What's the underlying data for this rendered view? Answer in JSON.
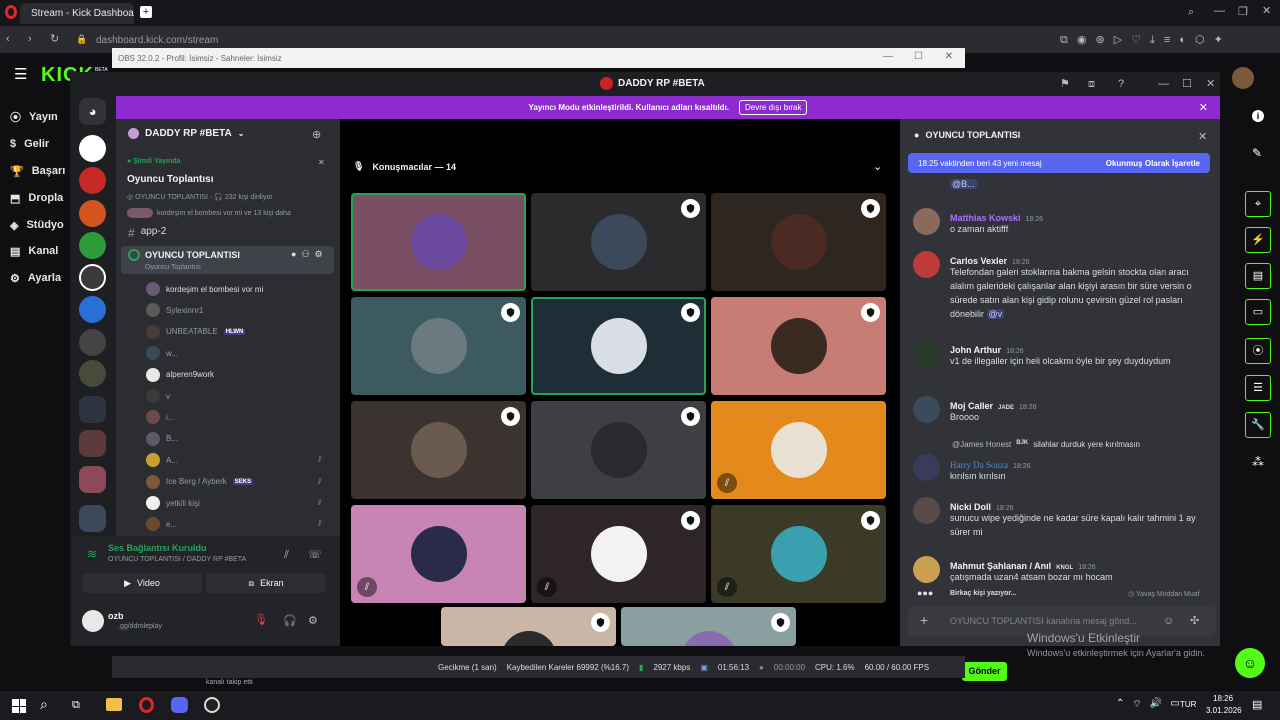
{
  "browser": {
    "tab_title": "Stream - Kick Dashboard",
    "url": "dashboard.kick.com/stream",
    "url_suffix": "/stream",
    "url_domain": "dashboard.kick.com"
  },
  "obs": {
    "title": "OBS 32.0.2 - Profil: İsimsiz - Sahneler: İsimsiz",
    "status": {
      "delay": "Gecikme (1 san)",
      "dropped": "Kaybedilen Kareler 69992 (%16.7)",
      "bitrate": "2927 kbps",
      "rec_time": "01:56:13",
      "stream_time": "00:00:00",
      "cpu": "CPU: 1.6%",
      "fps": "60.00 / 60.00 FPS"
    },
    "below_text": "kanalı takip etti"
  },
  "kick": {
    "logo": "KICK",
    "beta": "BETA",
    "nav": [
      "Yayın",
      "Gelir",
      "Başarı",
      "Dropla",
      "Stüdyo",
      "Kanal",
      "Ayarla"
    ],
    "send_button": "Gönder"
  },
  "discord": {
    "title": "DADDY RP #BETA",
    "banner_text": "Yayıncı Modu etkinleştirildi. Kullanıcı adları kısaltıldı.",
    "banner_button": "Devre dışı bırak",
    "server_name": "DADDY RP #BETA",
    "live_label": "Şimdi Yayında",
    "live_title": "Oyuncu Toplantısı",
    "live_channel": "OYUNCU TOPLANTISI",
    "live_listeners": "232 kişi dinliyor",
    "live_sub": "kordeşim el bombesi vor mi ve 13 kişi daha",
    "text_channel": "app-2",
    "voice_channel": "OYUNCU TOPLANTISI",
    "voice_sub": "Oyuncu Toplantısı",
    "members": [
      {
        "name": "kordeşim el bombesi vor mi",
        "badge": "",
        "muted": false,
        "color": "#dbdee1"
      },
      {
        "name": "Sylexinnr1",
        "badge": "",
        "muted": false,
        "color": "#949ba4"
      },
      {
        "name": "UNBEATABLE",
        "badge": "HLWN",
        "muted": false,
        "color": "#949ba4"
      },
      {
        "name": "w...",
        "badge": "",
        "muted": false,
        "color": "#949ba4"
      },
      {
        "name": "alperen9work",
        "badge": "",
        "muted": false,
        "color": "#dbdee1"
      },
      {
        "name": "v",
        "badge": "",
        "muted": false,
        "color": "#949ba4"
      },
      {
        "name": "i...",
        "badge": "",
        "muted": false,
        "color": "#949ba4"
      },
      {
        "name": "B...",
        "badge": "",
        "muted": false,
        "color": "#949ba4"
      },
      {
        "name": "A...",
        "badge": "",
        "muted": true,
        "color": "#949ba4"
      },
      {
        "name": "Ice Berg / Ayberk",
        "badge": "SEKS",
        "muted": true,
        "color": "#949ba4"
      },
      {
        "name": "yetkili kişi",
        "badge": "",
        "muted": true,
        "color": "#949ba4"
      },
      {
        "name": "e...",
        "badge": "",
        "muted": true,
        "color": "#949ba4"
      }
    ],
    "voice_status": "Ses Bağlantısı Kuruldu",
    "voice_status_sub": "OYUNCU TOPLANTISI / DADDY RP #BETA",
    "video_button": "Video",
    "screen_button": "Ekran",
    "user_name": "ozb",
    "user_status": ".gg/ddroleplay",
    "speakers_label": "Konuşmacılar — 14",
    "tiles": [
      {
        "bg": "#7a4e63",
        "avatar": "#6b4aa0",
        "mod": false,
        "muted": false,
        "speaking": true
      },
      {
        "bg": "#2b2b2d",
        "avatar": "#3a4a5a",
        "mod": true,
        "muted": false,
        "speaking": false
      },
      {
        "bg": "#2e2621",
        "avatar": "#4a2a22",
        "mod": true,
        "muted": false,
        "speaking": false
      },
      {
        "bg": "#3d5a60",
        "avatar": "#6a7a80",
        "mod": true,
        "muted": false,
        "speaking": false
      },
      {
        "bg": "#1f2e36",
        "avatar": "#d8dde6",
        "mod": true,
        "muted": false,
        "speaking": true
      },
      {
        "bg": "#c77c74",
        "avatar": "#3a2a22",
        "mod": true,
        "muted": false,
        "speaking": false
      },
      {
        "bg": "#3a3330",
        "avatar": "#6b5a4e",
        "mod": true,
        "muted": false,
        "speaking": false
      },
      {
        "bg": "#3d3f43",
        "avatar": "#2a2a2e",
        "mod": true,
        "muted": false,
        "speaking": false
      },
      {
        "bg": "#e48a1c",
        "avatar": "#e8e0d0",
        "mod": false,
        "muted": true,
        "speaking": false
      },
      {
        "bg": "#c784b4",
        "avatar": "#2a2a4a",
        "mod": false,
        "muted": true,
        "speaking": false
      },
      {
        "bg": "#2e2626",
        "avatar": "#f2f2f2",
        "mod": true,
        "muted": true,
        "speaking": false
      },
      {
        "bg": "#3a3a26",
        "avatar": "#3aa0b0",
        "mod": true,
        "muted": true,
        "speaking": false
      },
      {
        "bg": "#c9b6a6",
        "avatar": "#2a2a2a",
        "mod": true,
        "muted": false,
        "speaking": false
      },
      {
        "bg": "#8aa0a0",
        "avatar": "#8a6ab0",
        "mod": true,
        "muted": false,
        "speaking": false
      }
    ],
    "chat": {
      "title": "OYUNCU TOPLANTISI",
      "new_messages": "18:25 vaktinden beri 43 yeni mesaj",
      "mark_read": "Okunmuş Olarak İşaretle",
      "mention_top": "@B...",
      "messages": [
        {
          "name": "Matthias Kowski",
          "color": "#a970ff",
          "time": "18:26",
          "badge": "",
          "text": "o zaman aktifff",
          "avatar": "#8a6a5a"
        },
        {
          "name": "Carlos Vexler",
          "color": "#f2f3f5",
          "time": "18:26",
          "badge": "",
          "text": "Telefondan galeri stoklarına bakma gelsin stockta olan aracı alalım galerideki çalışanlar alan kişiyi arasın bir süre versin o sürede satın alan kişi gidip rolunu çevirsin güzel rol pasları dönebilir",
          "mention": "@v",
          "avatar": "#c03a3a"
        },
        {
          "name": "John Arthur",
          "color": "#f2f3f5",
          "time": "18:26",
          "badge": "",
          "text": "v1 de illegaller için heli olcakmı öyle bir şey duyduydum",
          "avatar": "#2a3a2a"
        },
        {
          "name": "Moj Caller",
          "color": "#f2f3f5",
          "time": "18:26",
          "badge": "JADE",
          "text": "Broooo",
          "avatar": "#3a4a5a"
        },
        {
          "name": "Harry Da Souza",
          "color": "#4a8ad8",
          "time": "18:26",
          "badge": "",
          "reply_user": "@James Honest",
          "reply_badge": "BJK",
          "reply_text": "silahlar durduk yere kırılmasın",
          "text": "kırılsın kırılsın",
          "avatar": "#3a3a5a"
        },
        {
          "name": "Nicki Doll",
          "color": "#f2f3f5",
          "time": "18:26",
          "badge": "",
          "text": "sunucu wipe yediğinde ne kadar süre kapalı kalır tahmini 1 ay sürer mi",
          "avatar": "#5a4a4a"
        },
        {
          "name": "Mahmut Şahlanan / Anıl",
          "color": "#f2f3f5",
          "time": "18:26",
          "badge": "KNGL",
          "text": "çatışmada uzan4 atsam bozar mı hocam",
          "avatar": "#c8a050"
        }
      ],
      "typing": "Birkaç kişi yazıyor...",
      "slowmode": "Yavaş Moddan Muaf",
      "input_placeholder": "OYUNCU TOPLANTISI kanalına mesaj gönd..."
    }
  },
  "windows": {
    "activate_title": "Windows'u Etkinleştir",
    "activate_sub": "Windows'u etkinleştirmek için Ayarlar'a gidin.",
    "lang": "TUR",
    "time": "18:26",
    "date": "3.01.2026"
  }
}
